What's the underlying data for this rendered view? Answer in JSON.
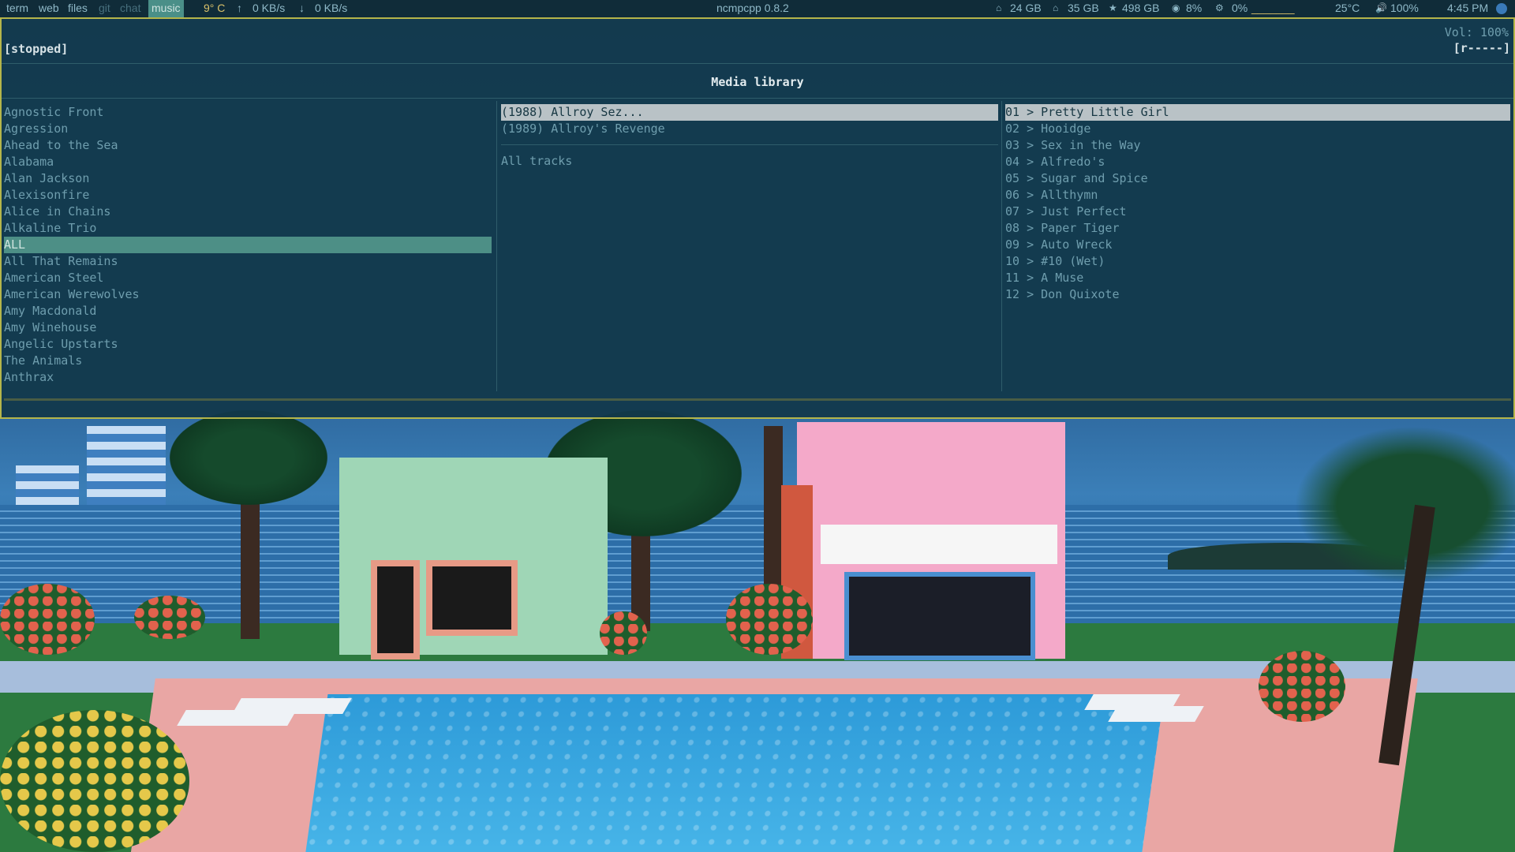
{
  "topbar": {
    "tags": [
      "term",
      "web",
      "files",
      "git",
      "chat",
      "music"
    ],
    "active_tag": "music",
    "weather": "9° C",
    "upload": "0 KB/s",
    "download": "0 KB/s",
    "center_title": "ncmpcpp 0.8.2",
    "disk_root": "24 GB",
    "disk_home": "35 GB",
    "disk_data": "498 GB",
    "memory": "8%",
    "cpu": "0%",
    "cpu_graph": "_______",
    "temperature": "25°C",
    "volume": "100%",
    "clock": "4:45 PM"
  },
  "player": {
    "state": "[stopped]",
    "volume": "Vol: 100%",
    "flags": "[r-----]",
    "screen_title": "Media library"
  },
  "artists": [
    "Agnostic Front",
    "Agression",
    "Ahead to the Sea",
    "Alabama",
    "Alan Jackson",
    "Alexisonfire",
    "Alice in Chains",
    "Alkaline Trio",
    "ALL",
    "All That Remains",
    "American Steel",
    "American Werewolves",
    "Amy Macdonald",
    "Amy Winehouse",
    "Angelic Upstarts",
    "The Animals",
    "Anthrax"
  ],
  "selected_artist_index": 8,
  "albums": [
    "(1988) Allroy Sez...",
    "(1989) Allroy's Revenge"
  ],
  "albums_all": "All tracks",
  "tracks": [
    "01 > Pretty Little Girl",
    "02 > Hooidge",
    "03 > Sex in the Way",
    "04 > Alfredo's",
    "05 > Sugar and Spice",
    "06 > Allthymn",
    "07 > Just Perfect",
    "08 > Paper Tiger",
    "09 > Auto Wreck",
    "10 > #10 (Wet)",
    "11 > A Muse",
    "12 > Don Quixote"
  ],
  "colors": {
    "border": "#b5b54a",
    "selection_green": "#4d8f86",
    "selection_grey": "#b9c2c6",
    "text": "#6f9eae"
  }
}
